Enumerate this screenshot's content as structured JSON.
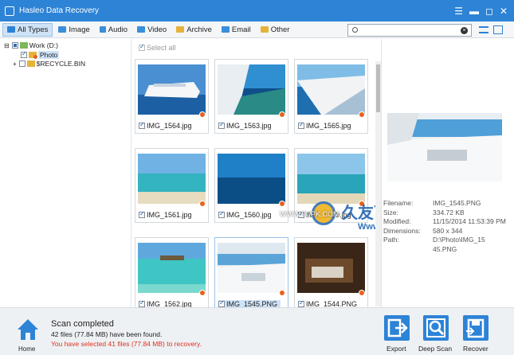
{
  "window": {
    "title": "Hasleo Data Recovery"
  },
  "tabs": [
    {
      "label": "All Types",
      "color": "#2d83d6"
    },
    {
      "label": "Image",
      "color": "#3b8fd9"
    },
    {
      "label": "Audio",
      "color": "#3b8fd9"
    },
    {
      "label": "Video",
      "color": "#3b8fd9"
    },
    {
      "label": "Archive",
      "color": "#e6b33a"
    },
    {
      "label": "Email",
      "color": "#3b8fd9"
    },
    {
      "label": "Other",
      "color": "#e6b33a"
    }
  ],
  "search": {
    "placeholder": ""
  },
  "tree": {
    "root": "Work (D:)",
    "children": [
      "Photo",
      "$RECYCLE.BIN"
    ]
  },
  "grid": {
    "select_all": "Select all",
    "files": [
      {
        "name": "IMG_1564.jpg",
        "checked": true
      },
      {
        "name": "IMG_1563.jpg",
        "checked": true
      },
      {
        "name": "IMG_1565.jpg",
        "checked": true
      },
      {
        "name": "IMG_1561.jpg",
        "checked": true
      },
      {
        "name": "IMG_1560.jpg",
        "checked": true
      },
      {
        "name": "IMG_1559.jpg",
        "checked": true
      },
      {
        "name": "IMG_1562.jpg",
        "checked": true
      },
      {
        "name": "IMG_1545.PNG",
        "checked": true
      },
      {
        "name": "IMG_1544.PNG",
        "checked": true
      }
    ]
  },
  "preview": {
    "labels": [
      "Filename:",
      "Size:",
      "Modified:",
      "Dimensions:",
      "Path:"
    ],
    "values": [
      "IMG_1545.PNG",
      "334.72 KB",
      "11/15/2014 11:53:39 PM",
      "580 x 344",
      "D:\\Photo\\IMG_1545.PNG"
    ]
  },
  "status": {
    "title": "Scan completed",
    "found": "42 files (77.84 MB) have been found.",
    "selected": "You have selected 41 files (77.84 MB) to recovery."
  },
  "actions": {
    "home": "Home",
    "export": "Export",
    "deep_scan": "Deep Scan",
    "recover": "Recover"
  },
  "watermark": {
    "brand": "久友下载站",
    "url": "Www.9UPK.Com",
    "url_small": "WWW.9UPK.COM"
  }
}
